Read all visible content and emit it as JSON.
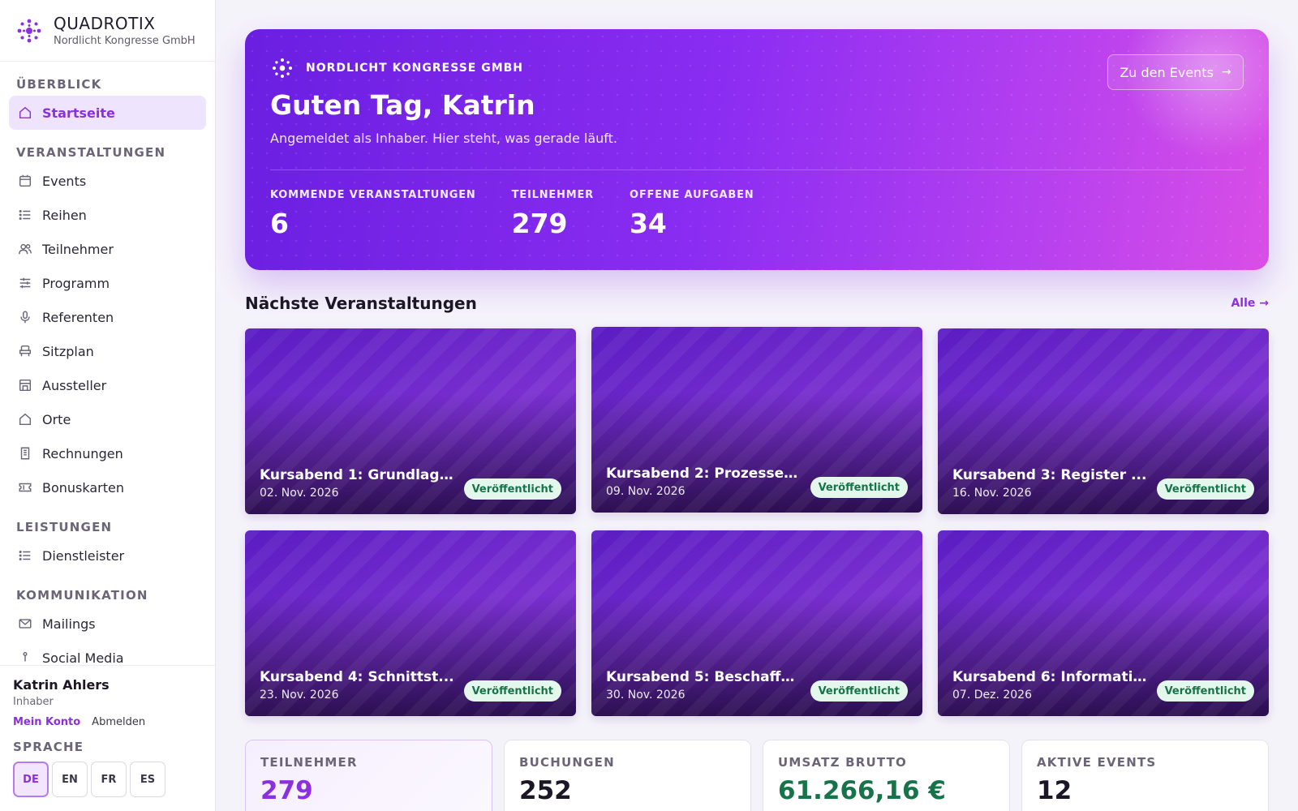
{
  "brand": {
    "name": "QUADROTIX",
    "company": "Nordlicht Kongresse GmbH",
    "accent": "#8b2fe0"
  },
  "nav": {
    "sections": [
      {
        "title": "ÜBERBLICK",
        "items": [
          {
            "label": "Startseite",
            "icon": "home-icon",
            "active": true
          }
        ]
      },
      {
        "title": "VERANSTALTUNGEN",
        "items": [
          {
            "label": "Events",
            "icon": "calendar-icon"
          },
          {
            "label": "Reihen",
            "icon": "list-icon"
          },
          {
            "label": "Teilnehmer",
            "icon": "users-icon"
          },
          {
            "label": "Programm",
            "icon": "sliders-icon"
          },
          {
            "label": "Referenten",
            "icon": "microphone-icon"
          },
          {
            "label": "Sitzplan",
            "icon": "seat-icon"
          },
          {
            "label": "Aussteller",
            "icon": "store-icon"
          },
          {
            "label": "Orte",
            "icon": "home-icon"
          },
          {
            "label": "Rechnungen",
            "icon": "receipt-icon"
          },
          {
            "label": "Bonuskarten",
            "icon": "ticket-icon"
          }
        ]
      },
      {
        "title": "LEISTUNGEN",
        "items": [
          {
            "label": "Dienstleister",
            "icon": "list-icon"
          }
        ]
      },
      {
        "title": "KOMMUNIKATION",
        "items": [
          {
            "label": "Mailings",
            "icon": "mail-icon"
          },
          {
            "label": "Social Media",
            "icon": "share-icon"
          }
        ]
      }
    ]
  },
  "user": {
    "name": "Katrin Ahlers",
    "role": "Inhaber",
    "account_label": "Mein Konto",
    "logout_label": "Abmelden"
  },
  "language": {
    "title": "SPRACHE",
    "options": [
      "DE",
      "EN",
      "FR",
      "ES"
    ],
    "selected": "DE"
  },
  "hero": {
    "org": "NORDLICHT KONGRESSE GMBH",
    "title": "Guten Tag, Katrin",
    "subtitle": "Angemeldet als Inhaber. Hier steht, was gerade läuft.",
    "button": "Zu den Events",
    "stats": [
      {
        "label": "KOMMENDE VERANSTALTUNGEN",
        "value": "6"
      },
      {
        "label": "TEILNEHMER",
        "value": "279"
      },
      {
        "label": "OFFENE AUFGABEN",
        "value": "34"
      }
    ]
  },
  "upcoming": {
    "title": "Nächste Veranstaltungen",
    "link": "Alle",
    "events": [
      {
        "title": "Kursabend 1: Grundlag...",
        "date": "02. Nov. 2026",
        "status": "Veröffentlicht"
      },
      {
        "title": "Kursabend 2: Prozesse ...",
        "date": "09. Nov. 2026",
        "status": "Veröffentlicht"
      },
      {
        "title": "Kursabend 3: Register ...",
        "date": "16. Nov. 2026",
        "status": "Veröffentlicht"
      },
      {
        "title": "Kursabend 4: Schnittst...",
        "date": "23. Nov. 2026",
        "status": "Veröffentlicht"
      },
      {
        "title": "Kursabend 5: Beschaffu...",
        "date": "30. Nov. 2026",
        "status": "Veröffentlicht"
      },
      {
        "title": "Kursabend 6: Informati...",
        "date": "07. Dez. 2026",
        "status": "Veröffentlicht"
      }
    ]
  },
  "stats": [
    {
      "label": "TEILNEHMER",
      "value": "279",
      "color": "#8b2fe0"
    },
    {
      "label": "BUCHUNGEN",
      "value": "252",
      "color": "#1b1726"
    },
    {
      "label": "UMSATZ BRUTTO",
      "value": "61.266,16 €",
      "color": "#17734a"
    },
    {
      "label": "AKTIVE EVENTS",
      "value": "12",
      "color": "#1b1726"
    }
  ]
}
